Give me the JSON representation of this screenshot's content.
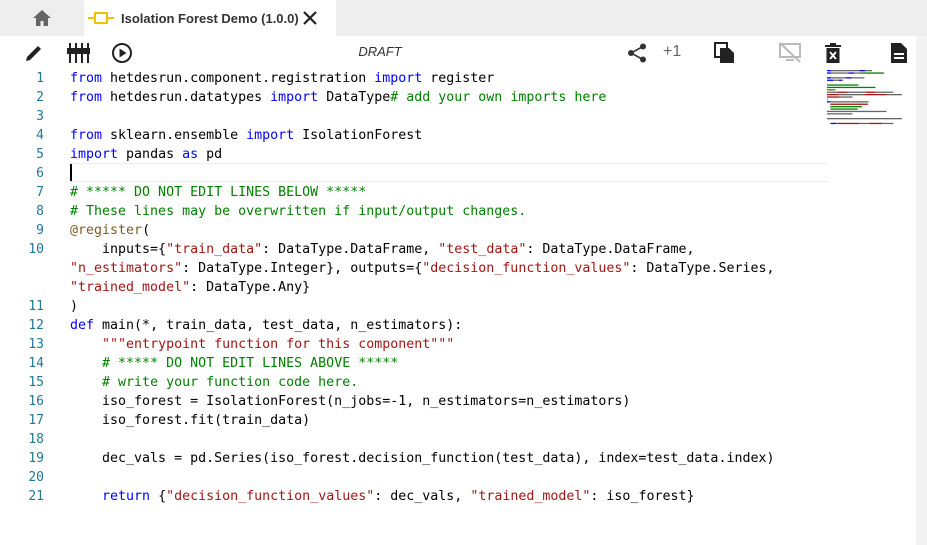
{
  "tab": {
    "title": "Isolation Forest Demo (1.0.0)"
  },
  "toolbar": {
    "status": "DRAFT",
    "increment": "+1"
  },
  "icons": {
    "home": "home-icon",
    "component": "component-icon",
    "close": "close-icon",
    "edit": "pencil-icon",
    "io": "io-config-icon",
    "run": "play-circle-icon",
    "share": "share-icon",
    "copy": "copy-icon",
    "disabled": "monitor-off-icon",
    "delete": "delete-icon",
    "doc": "document-icon"
  },
  "editor": {
    "line_numbers": [
      "1",
      "2",
      "3",
      "4",
      "5",
      "6",
      "7",
      "8",
      "9",
      "10",
      "11",
      "12",
      "13",
      "14",
      "15",
      "16",
      "17",
      "18",
      "19",
      "20",
      "21"
    ],
    "lines": [
      [
        {
          "t": "from ",
          "c": "kw"
        },
        {
          "t": "hetdesrun.component.registration "
        },
        {
          "t": "import ",
          "c": "kw"
        },
        {
          "t": "register"
        }
      ],
      [
        {
          "t": "from ",
          "c": "kw"
        },
        {
          "t": "hetdesrun.datatypes "
        },
        {
          "t": "import ",
          "c": "kw"
        },
        {
          "t": "DataType"
        },
        {
          "t": "# add your own imports here",
          "c": "cm"
        }
      ],
      [],
      [
        {
          "t": "from ",
          "c": "kw"
        },
        {
          "t": "sklearn.ensemble "
        },
        {
          "t": "import ",
          "c": "kw"
        },
        {
          "t": "IsolationForest"
        }
      ],
      [
        {
          "t": "import ",
          "c": "kw"
        },
        {
          "t": "pandas "
        },
        {
          "t": "as ",
          "c": "kw"
        },
        {
          "t": "pd"
        }
      ],
      [],
      [
        {
          "t": "# ***** DO NOT EDIT LINES BELOW *****",
          "c": "cm"
        }
      ],
      [
        {
          "t": "# These lines may be overwritten if input/output changes.",
          "c": "cm"
        }
      ],
      [
        {
          "t": "@register",
          "c": "dc"
        },
        {
          "t": "("
        }
      ],
      [
        {
          "t": "    inputs={"
        },
        {
          "t": "\"train_data\"",
          "c": "str"
        },
        {
          "t": ": DataType.DataFrame, "
        },
        {
          "t": "\"test_data\"",
          "c": "str"
        },
        {
          "t": ": DataType.DataFrame,"
        }
      ],
      [
        {
          "t": "\"n_estimators\"",
          "c": "str"
        },
        {
          "t": ": DataType.Integer}, outputs={"
        },
        {
          "t": "\"decision_function_values\"",
          "c": "str"
        },
        {
          "t": ": DataType.Series,"
        }
      ],
      [
        {
          "t": "\"trained_model\"",
          "c": "str"
        },
        {
          "t": ": DataType.Any}"
        }
      ],
      [
        {
          "t": ")"
        }
      ],
      [
        {
          "t": "def ",
          "c": "kw"
        },
        {
          "t": "main(*, train_data, test_data, n_estimators):"
        }
      ],
      [
        {
          "t": "    "
        },
        {
          "t": "\"\"\"entrypoint function for this component\"\"\"",
          "c": "str"
        }
      ],
      [
        {
          "t": "    "
        },
        {
          "t": "# ***** DO NOT EDIT LINES ABOVE *****",
          "c": "cm"
        }
      ],
      [
        {
          "t": "    "
        },
        {
          "t": "# write your function code here.",
          "c": "cm"
        }
      ],
      [
        {
          "t": "    iso_forest = IsolationForest(n_jobs=-1, n_estimators=n_estimators)"
        }
      ],
      [
        {
          "t": "    iso_forest.fit(train_data)"
        }
      ],
      [],
      [
        {
          "t": "    dec_vals = pd.Series(iso_forest.decision_function(test_data), index=test_data.index)"
        }
      ],
      [],
      [
        {
          "t": "    "
        },
        {
          "t": "return ",
          "c": "kw"
        },
        {
          "t": "{"
        },
        {
          "t": "\"decision_function_values\"",
          "c": "str"
        },
        {
          "t": ": dec_vals, "
        },
        {
          "t": "\"trained_model\"",
          "c": "str"
        },
        {
          "t": ": iso_forest}"
        }
      ]
    ]
  }
}
